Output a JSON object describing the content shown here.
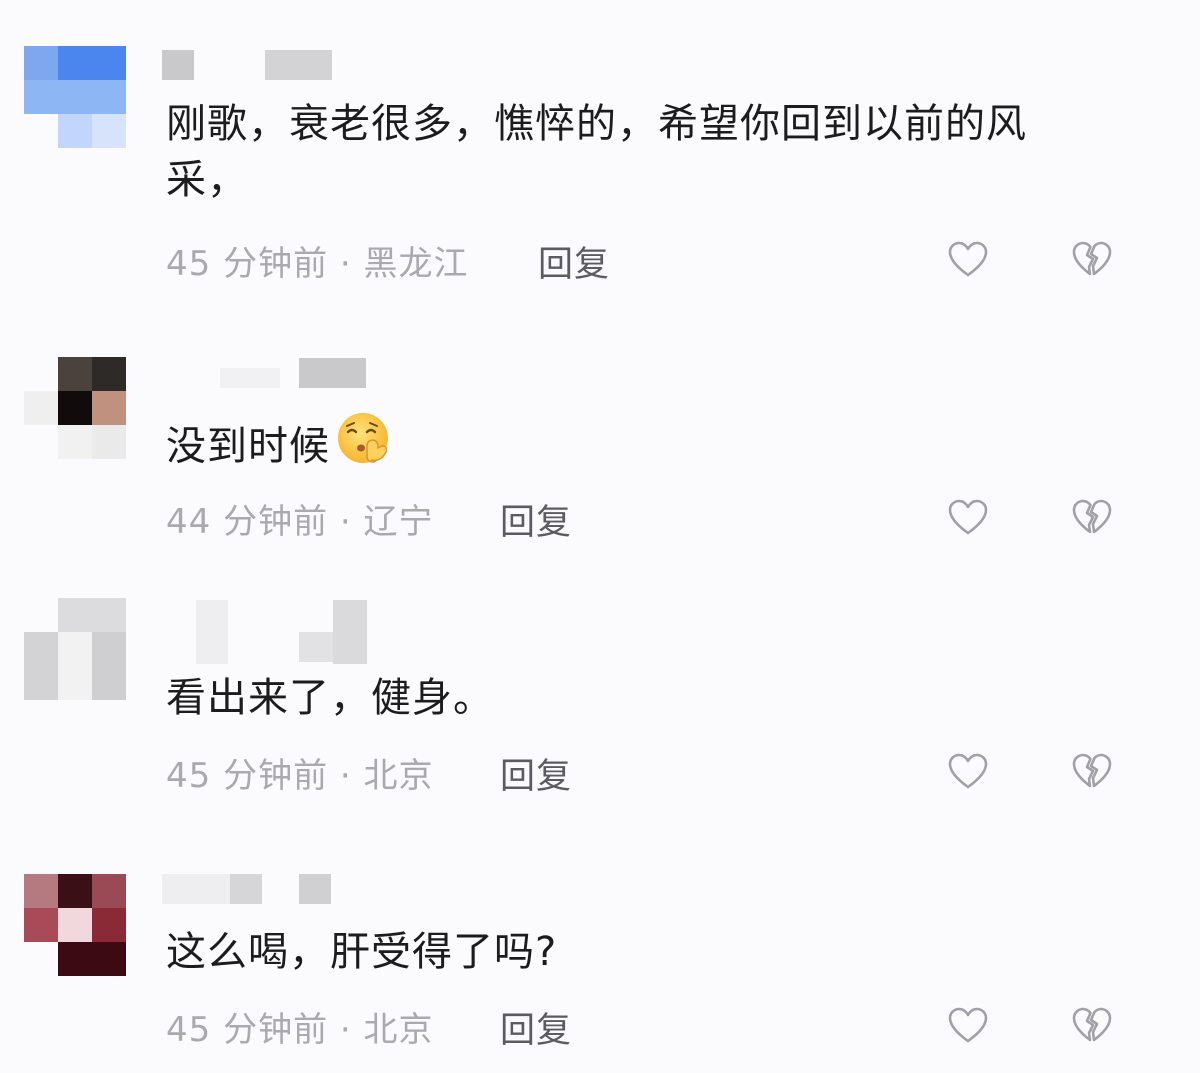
{
  "colors": {
    "background": "#fbfbfd",
    "content_text": "#1c1c1e",
    "meta_text": "#a9a9ae",
    "reply_text": "#5b5b60",
    "icon_stroke": "#a0a0a6"
  },
  "comments": [
    {
      "text": "刚歌，衰老很多，憔悴的，希望你回到以前的风采，",
      "meta": "45 分钟前 · 黑龙江",
      "reply_label": "回复",
      "like_icon": "heart-outline-icon",
      "dislike_icon": "broken-heart-icon"
    },
    {
      "text": "没到时候",
      "emoji": "shushing-face-emoji",
      "meta": "44 分钟前 · 辽宁",
      "reply_label": "回复",
      "like_icon": "heart-outline-icon",
      "dislike_icon": "broken-heart-icon"
    },
    {
      "text": "看出来了，健身。",
      "meta": "45 分钟前 · 北京",
      "reply_label": "回复",
      "like_icon": "heart-outline-icon",
      "dislike_icon": "broken-heart-icon"
    },
    {
      "text": "这么喝，肝受得了吗?",
      "meta": "45 分钟前 · 北京",
      "reply_label": "回复",
      "like_icon": "heart-outline-icon",
      "dislike_icon": "broken-heart-icon"
    }
  ]
}
